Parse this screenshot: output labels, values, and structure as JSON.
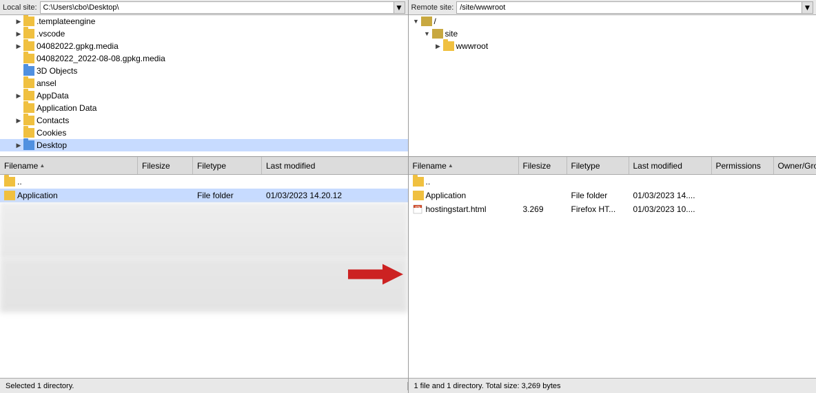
{
  "local_pane": {
    "header_label": "Local site:",
    "path": "C:\\Users\\cbo\\Desktop\\",
    "tree_items": [
      {
        "id": "templateengine",
        "label": ".templateengine",
        "indent": 2,
        "type": "folder_yellow",
        "expanded": false,
        "has_children": true
      },
      {
        "id": "vscode",
        "label": ".vscode",
        "indent": 2,
        "type": "folder_yellow",
        "expanded": false,
        "has_children": true
      },
      {
        "id": "04082022gpkg",
        "label": "04082022.gpkg.media",
        "indent": 2,
        "type": "folder_yellow",
        "expanded": false,
        "has_children": true
      },
      {
        "id": "04082022_2022",
        "label": "04082022_2022-08-08.gpkg.media",
        "indent": 2,
        "type": "folder_yellow",
        "expanded": false,
        "has_children": false
      },
      {
        "id": "3dobjects",
        "label": "3D Objects",
        "indent": 2,
        "type": "folder_blue",
        "expanded": false,
        "has_children": false
      },
      {
        "id": "ansel",
        "label": "ansel",
        "indent": 2,
        "type": "folder_yellow",
        "expanded": false,
        "has_children": false
      },
      {
        "id": "appdata",
        "label": "AppData",
        "indent": 2,
        "type": "folder_yellow",
        "expanded": false,
        "has_children": true
      },
      {
        "id": "applicationdata",
        "label": "Application Data",
        "indent": 2,
        "type": "folder_yellow",
        "expanded": false,
        "has_children": false
      },
      {
        "id": "contacts",
        "label": "Contacts",
        "indent": 2,
        "type": "folder_yellow",
        "expanded": false,
        "has_children": true
      },
      {
        "id": "cookies",
        "label": "Cookies",
        "indent": 2,
        "type": "folder_yellow",
        "expanded": false,
        "has_children": false
      },
      {
        "id": "desktop",
        "label": "Desktop",
        "indent": 2,
        "type": "folder_blue",
        "expanded": false,
        "has_children": true
      }
    ]
  },
  "remote_pane": {
    "header_label": "Remote site:",
    "path": "/site/wwwroot",
    "tree_items": [
      {
        "id": "root_slash",
        "label": "/",
        "indent": 0,
        "type": "folder_question",
        "expanded": true,
        "has_children": true
      },
      {
        "id": "site",
        "label": "site",
        "indent": 1,
        "type": "folder_question",
        "expanded": true,
        "has_children": true
      },
      {
        "id": "wwwroot",
        "label": "wwwroot",
        "indent": 2,
        "type": "folder_yellow",
        "expanded": false,
        "has_children": true
      }
    ]
  },
  "local_files": {
    "columns": [
      {
        "id": "filename",
        "label": "Filename"
      },
      {
        "id": "filesize",
        "label": "Filesize"
      },
      {
        "id": "filetype",
        "label": "Filetype"
      },
      {
        "id": "lastmodified",
        "label": "Last modified"
      }
    ],
    "rows": [
      {
        "id": "parent",
        "filename": "..",
        "filesize": "",
        "filetype": "",
        "lastmodified": "",
        "type": "parent"
      },
      {
        "id": "application",
        "filename": "Application",
        "filesize": "",
        "filetype": "File folder",
        "lastmodified": "01/03/2023 14.20.12",
        "type": "folder",
        "selected": true
      }
    ],
    "blurred_rows": 4
  },
  "remote_files": {
    "columns": [
      {
        "id": "filename",
        "label": "Filename"
      },
      {
        "id": "filesize",
        "label": "Filesize"
      },
      {
        "id": "filetype",
        "label": "Filetype"
      },
      {
        "id": "lastmodified",
        "label": "Last modified"
      },
      {
        "id": "permissions",
        "label": "Permissions"
      },
      {
        "id": "ownergroup",
        "label": "Owner/Group"
      }
    ],
    "rows": [
      {
        "id": "parent",
        "filename": "..",
        "filesize": "",
        "filetype": "",
        "lastmodified": "",
        "permissions": "",
        "ownergroup": "",
        "type": "parent"
      },
      {
        "id": "application",
        "filename": "Application",
        "filesize": "",
        "filetype": "File folder",
        "lastmodified": "01/03/2023 14....",
        "permissions": "",
        "ownergroup": "",
        "type": "folder"
      },
      {
        "id": "hostingstart",
        "filename": "hostingstart.html",
        "filesize": "3.269",
        "filetype": "Firefox HT...",
        "lastmodified": "01/03/2023 10....",
        "permissions": "",
        "ownergroup": "",
        "type": "html"
      }
    ]
  },
  "status": {
    "local": "Selected 1 directory.",
    "remote": "1 file and 1 directory. Total size: 3,269 bytes"
  }
}
